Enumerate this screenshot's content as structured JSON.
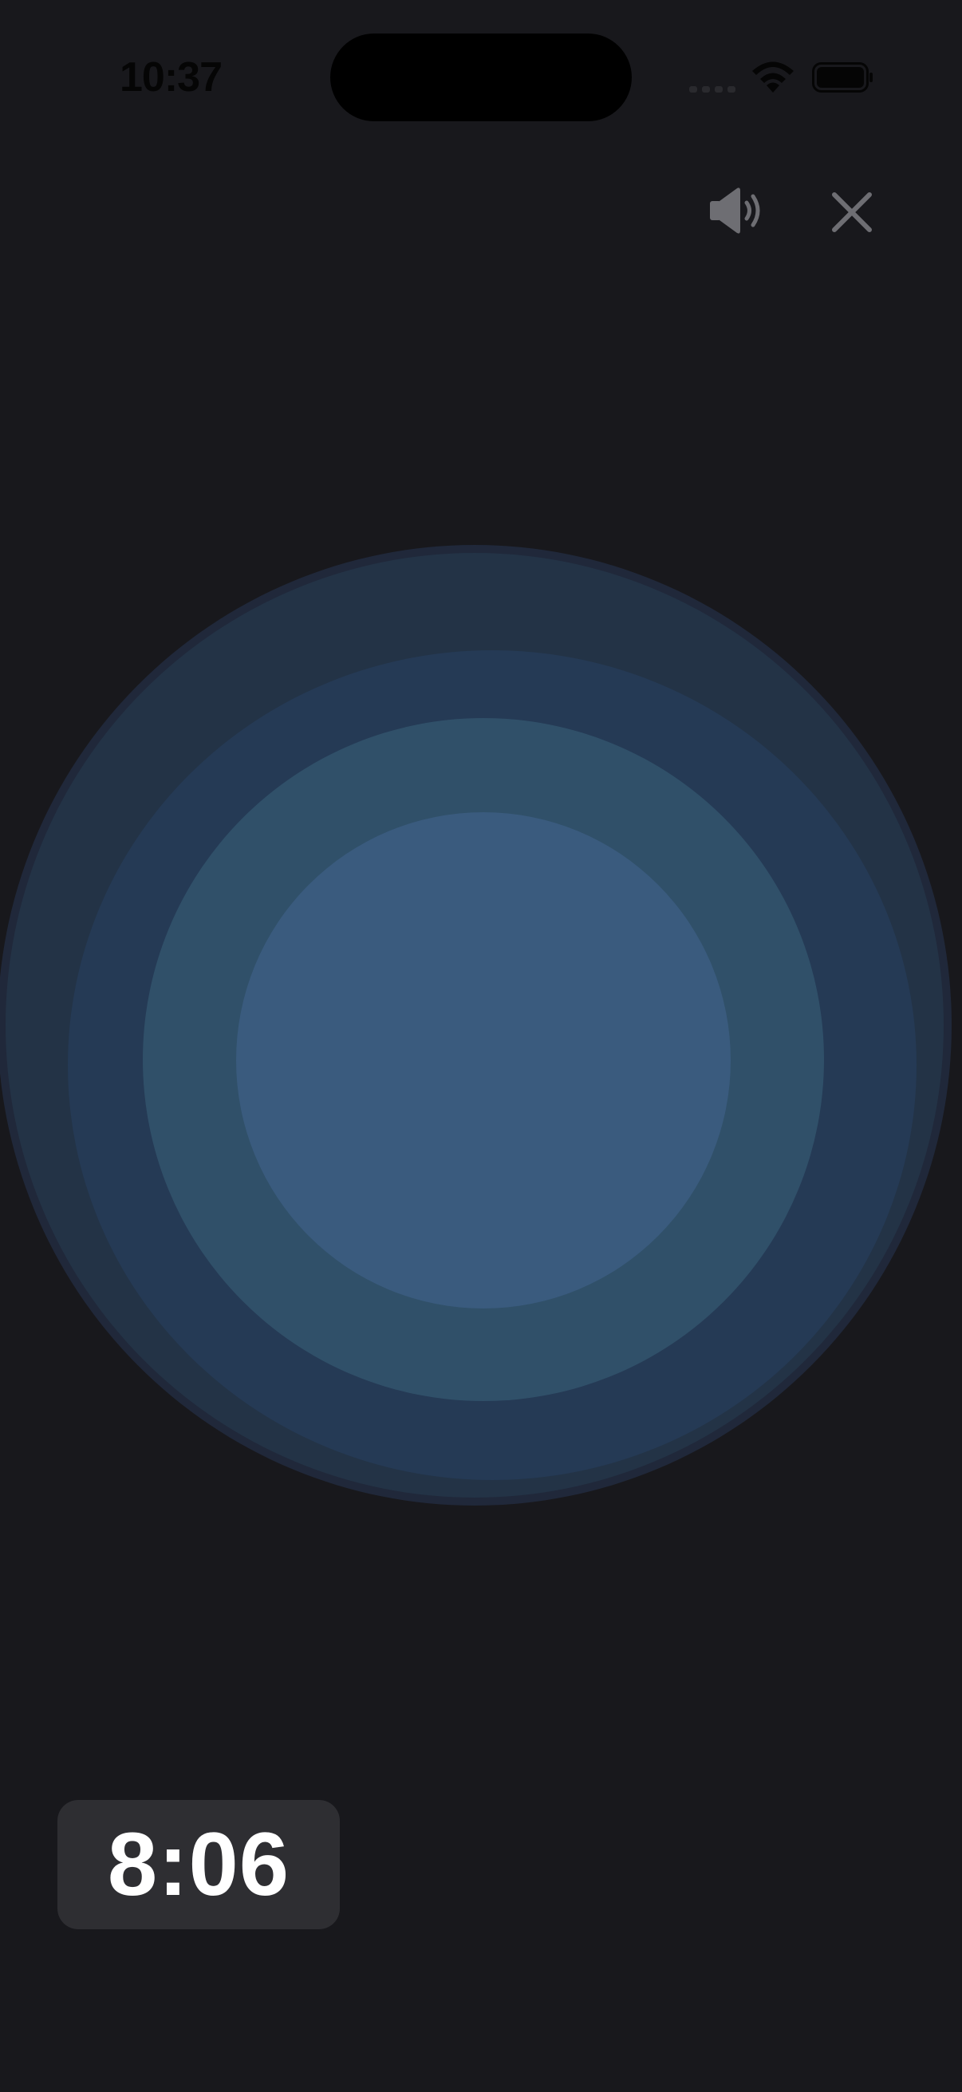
{
  "status_bar": {
    "time": "10:37",
    "icons": [
      "signal-icon",
      "wifi-icon",
      "battery-icon"
    ]
  },
  "controls": {
    "sound_icon": "speaker-icon",
    "close_icon": "close-icon"
  },
  "breathing_visual": {
    "rings": 5,
    "colors": [
      "#232f42",
      "#253a55",
      "#305069",
      "#3a5b7e"
    ]
  },
  "timer": {
    "value": "8:06"
  },
  "colors": {
    "background": "#18181c",
    "timer_background": "#2e2e32",
    "icon_gray": "#6e6e73"
  }
}
